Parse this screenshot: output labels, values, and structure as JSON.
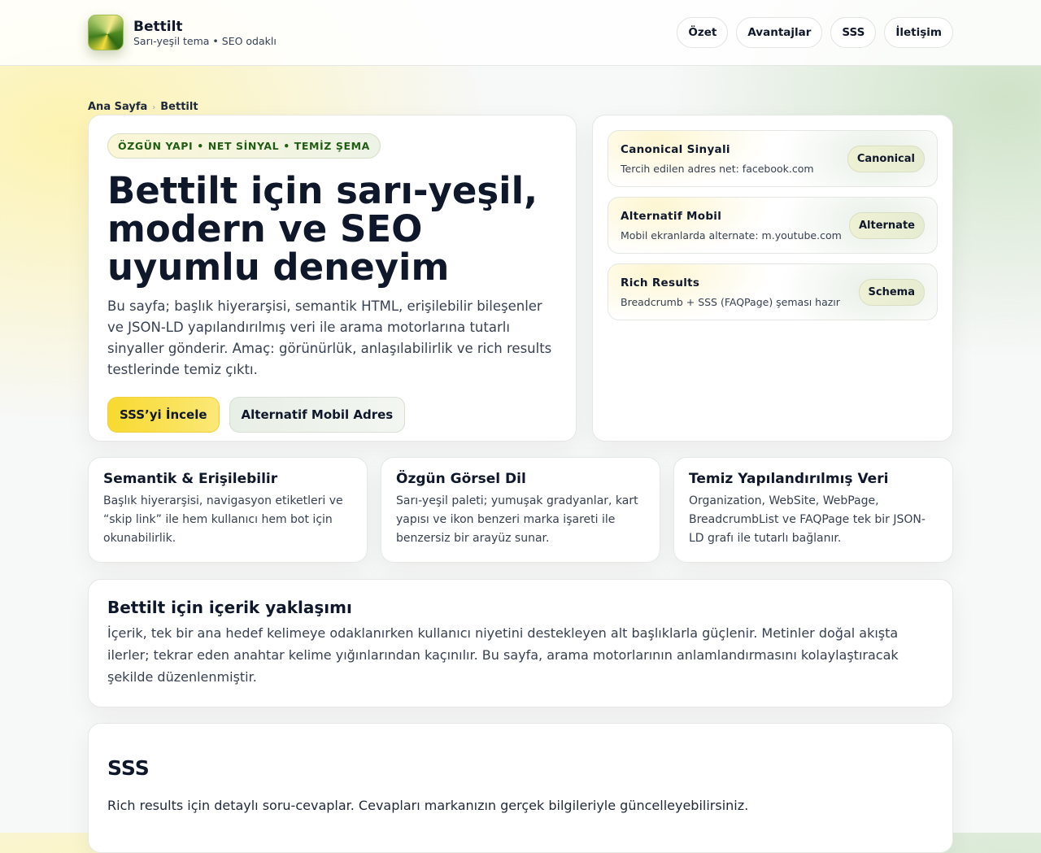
{
  "header": {
    "brand": "Bettilt",
    "tagline": "Sarı-yeşil tema • SEO odaklı",
    "nav": [
      "Özet",
      "Avantajlar",
      "SSS",
      "İletişim"
    ]
  },
  "breadcrumb": {
    "home": "Ana Sayfa",
    "sep": "›",
    "current": "Bettilt"
  },
  "hero": {
    "pill": "ÖZGÜN YAPI • NET SİNYAL • TEMİZ ŞEMA",
    "title": "Bettilt için sarı-yeşil, modern ve SEO uyumlu deneyim",
    "lead": "Bu sayfa; başlık hiyerarşisi, semantik HTML, erişilebilir bileşenler ve JSON-LD yapılandırılmış veri ile arama motorlarına tutarlı sinyaller gönderir. Amaç: görünürlük, anlaşılabilirlik ve rich results testlerinde temiz çıktı.",
    "primary": "SSS’yi İncele",
    "secondary": "Alternatif Mobil Adres"
  },
  "signals": [
    {
      "title": "Canonical Sinyali",
      "desc": "Tercih edilen adres net: facebook.com",
      "tag": "Canonical"
    },
    {
      "title": "Alternatif Mobil",
      "desc": "Mobil ekranlarda alternate: m.youtube.com",
      "tag": "Alternate"
    },
    {
      "title": "Rich Results",
      "desc": "Breadcrumb + SSS (FAQPage) şeması hazır",
      "tag": "Schema"
    }
  ],
  "features": [
    {
      "title": "Semantik & Erişilebilir",
      "desc": "Başlık hiyerarşisi, navigasyon etiketleri ve “skip link” ile hem kullanıcı hem bot için okunabilirlik."
    },
    {
      "title": "Özgün Görsel Dil",
      "desc": "Sarı-yeşil paleti; yumuşak gradyanlar, kart yapısı ve ikon benzeri marka işareti ile benzersiz bir arayüz sunar."
    },
    {
      "title": "Temiz Yapılandırılmış Veri",
      "desc": "Organization, WebSite, WebPage, BreadcrumbList ve FAQPage tek bir JSON-LD grafı ile tutarlı bağlanır."
    }
  ],
  "approach": {
    "title": "Bettilt için içerik yaklaşımı",
    "text": "İçerik, tek bir ana hedef kelimeye odaklanırken kullanıcı niyetini destekleyen alt başlıklarla güçlenir. Metinler doğal akışta ilerler; tekrar eden anahtar kelime yığınlarından kaçınılır. Bu sayfa, arama motorlarının anlamlandırmasını kolaylaştıracak şekilde düzenlenmiştir."
  },
  "faq": {
    "title": "SSS",
    "text": "Rich results için detaylı soru-cevaplar. Cevapları markanızın gerçek bilgileriyle güncelleyebilirsiniz."
  }
}
